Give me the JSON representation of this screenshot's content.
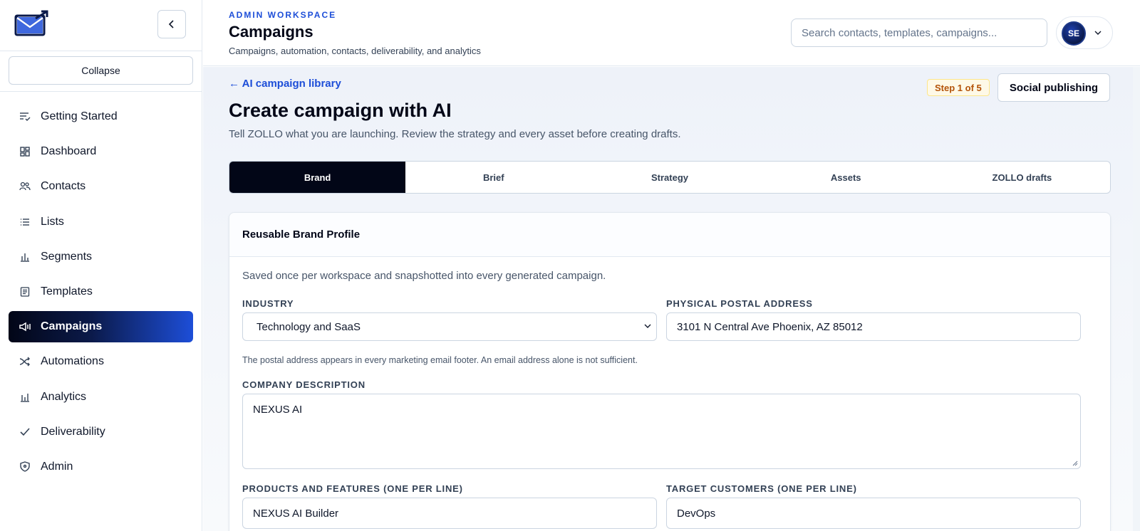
{
  "sidebar": {
    "logo_icon": "envelope-logo-icon",
    "collapse_chevron_icon": "chevron-left-icon",
    "collapse_label": "Collapse",
    "items": [
      {
        "label": "Getting Started",
        "icon": "checklist-icon"
      },
      {
        "label": "Dashboard",
        "icon": "dashboard-grid-icon"
      },
      {
        "label": "Contacts",
        "icon": "users-icon"
      },
      {
        "label": "Lists",
        "icon": "list-icon"
      },
      {
        "label": "Segments",
        "icon": "bar-chart-icon"
      },
      {
        "label": "Templates",
        "icon": "document-icon"
      },
      {
        "label": "Campaigns",
        "icon": "megaphone-icon",
        "active": true
      },
      {
        "label": "Automations",
        "icon": "shuffle-icon"
      },
      {
        "label": "Analytics",
        "icon": "analytics-icon"
      },
      {
        "label": "Deliverability",
        "icon": "check-icon"
      },
      {
        "label": "Admin",
        "icon": "shield-icon"
      }
    ]
  },
  "header": {
    "eyebrow": "ADMIN WORKSPACE",
    "title": "Campaigns",
    "subtitle": "Campaigns, automation, contacts, deliverability, and analytics",
    "search_placeholder": "Search contacts, templates, campaigns...",
    "user_initials": "SE"
  },
  "main": {
    "back_link": "← AI campaign library",
    "step_badge": "Step 1 of 5",
    "social_button": "Social publishing",
    "page_title": "Create campaign with AI",
    "page_description": "Tell ZOLLO what you are launching. Review the strategy and every asset before creating drafts.",
    "tabs": [
      {
        "label": "Brand",
        "active": true
      },
      {
        "label": "Brief"
      },
      {
        "label": "Strategy"
      },
      {
        "label": "Assets"
      },
      {
        "label": "ZOLLO drafts"
      }
    ],
    "card": {
      "title": "Reusable Brand Profile",
      "description": "Saved once per workspace and snapshotted into every generated campaign.",
      "industry_label": "INDUSTRY",
      "industry_value": "Technology and SaaS",
      "address_label": "PHYSICAL POSTAL ADDRESS",
      "address_value": "3101 N Central Ave Phoenix, AZ 85012",
      "address_help": "The postal address appears in every marketing email footer. An email address alone is not sufficient.",
      "company_label": "COMPANY DESCRIPTION",
      "company_value": "NEXUS AI",
      "products_label": "PRODUCTS AND FEATURES (ONE PER LINE)",
      "products_value": "NEXUS AI Builder",
      "customers_label": "TARGET CUSTOMERS (ONE PER LINE)",
      "customers_value": "DevOps"
    }
  },
  "colors": {
    "accent": "#1d4ed8",
    "active_nav_start": "#020617",
    "active_nav_end": "#1d4ed8",
    "badge_text": "#b45309",
    "badge_bg": "#fef9e7"
  }
}
